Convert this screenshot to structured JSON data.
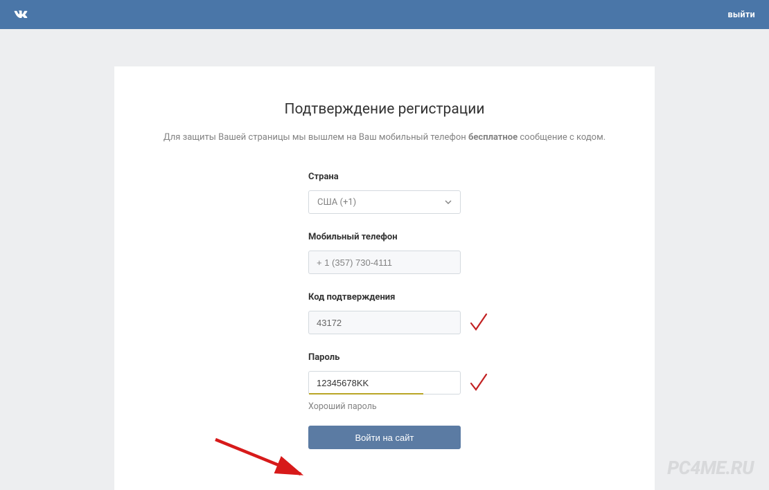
{
  "header": {
    "logout": "выйти"
  },
  "page": {
    "title": "Подтверждение регистрации",
    "subtitle_pre": "Для защиты Вашей страницы мы вышлем на Ваш мобильный телефон ",
    "subtitle_bold": "бесплатное",
    "subtitle_post": " сообщение с кодом."
  },
  "form": {
    "country": {
      "label": "Страна",
      "value": "США (+1)"
    },
    "phone": {
      "label": "Мобильный телефон",
      "value": "+ 1 (357) 730-4111"
    },
    "code": {
      "label": "Код подтверждения",
      "value": "43172"
    },
    "password": {
      "label": "Пароль",
      "value": "12345678KK",
      "hint": "Хороший пароль"
    },
    "submit": "Войти на сайт"
  },
  "watermark": "PC4ME.RU",
  "colors": {
    "header_bg": "#4a76a8",
    "page_bg": "#edeef0",
    "button_bg": "#5b7ba3",
    "check_red": "#c22122",
    "strength": "#b9a524"
  }
}
